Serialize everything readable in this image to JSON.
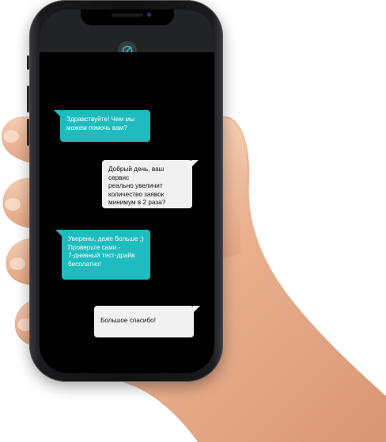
{
  "header": {
    "logo_icon": "teal-circle-slash-icon"
  },
  "chat": {
    "messages": [
      {
        "sender": "bot",
        "text": "Здравствуйте! Чем мы\nможем помочь вам?"
      },
      {
        "sender": "user",
        "text": "Добрый день, ваш сервис\nреально увеличит\nколичество заявок\nминимум в 2 раза?"
      },
      {
        "sender": "bot",
        "text": "Уверены, даже больше ;)\nПроверьте сами -\n7-дневный тест-драйв\nбесплатно!"
      },
      {
        "sender": "user",
        "text": "Большое спасибо!"
      }
    ]
  },
  "colors": {
    "accent": "#1fbcbf",
    "user_bubble": "#f1f1f2",
    "screen_bg": "#000000",
    "header_bg": "#222325"
  }
}
